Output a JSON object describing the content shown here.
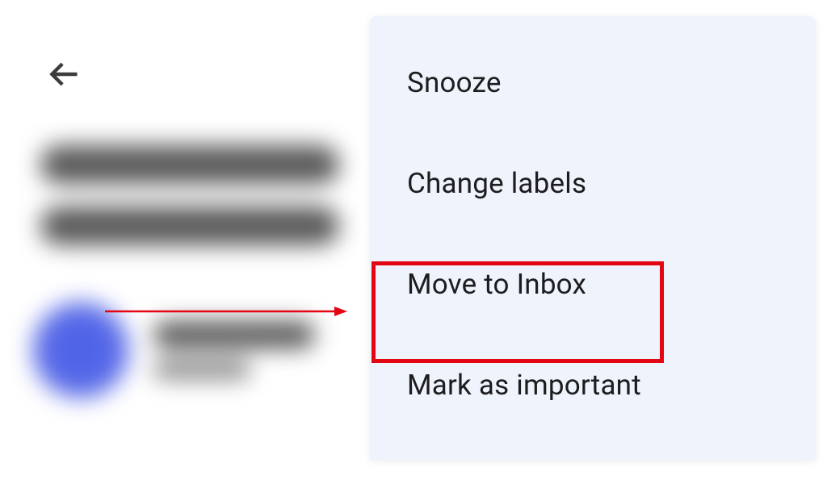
{
  "toolbar": {
    "back_icon": "arrow-left"
  },
  "menu": {
    "items": [
      {
        "label": "Snooze"
      },
      {
        "label": "Change labels"
      },
      {
        "label": "Move to Inbox"
      },
      {
        "label": "Mark as important"
      }
    ],
    "highlighted_index": 2
  },
  "annotation": {
    "arrow_color": "#e30613",
    "highlight_color": "#e30613"
  }
}
